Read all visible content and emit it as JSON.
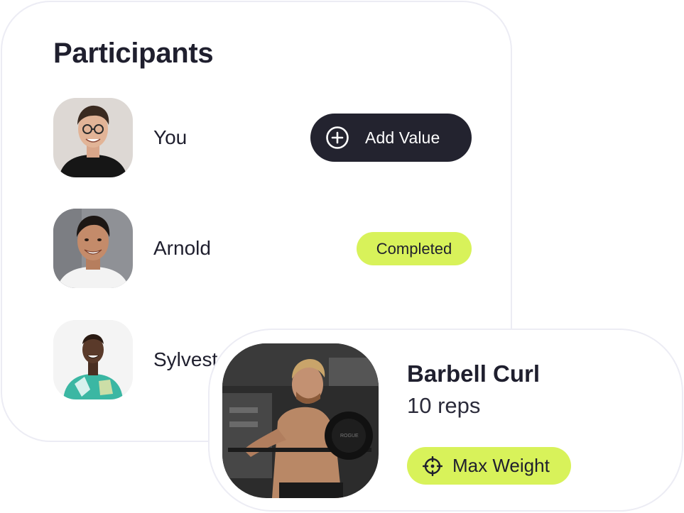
{
  "participants": {
    "title": "Participants",
    "list": [
      {
        "name": "You",
        "action": {
          "label": "Add Value",
          "icon": "plus-circle-icon"
        }
      },
      {
        "name": "Arnold",
        "status": "Completed"
      },
      {
        "name": "Sylvester"
      }
    ]
  },
  "exercise": {
    "name": "Barbell Curl",
    "reps": "10 reps",
    "badge": {
      "label": "Max Weight",
      "icon": "crosshair-icon"
    }
  },
  "colors": {
    "dark_button": "#23232f",
    "accent_lime": "#d8f25a",
    "card_border": "#ececf4",
    "text_primary": "#1f1f2e"
  }
}
